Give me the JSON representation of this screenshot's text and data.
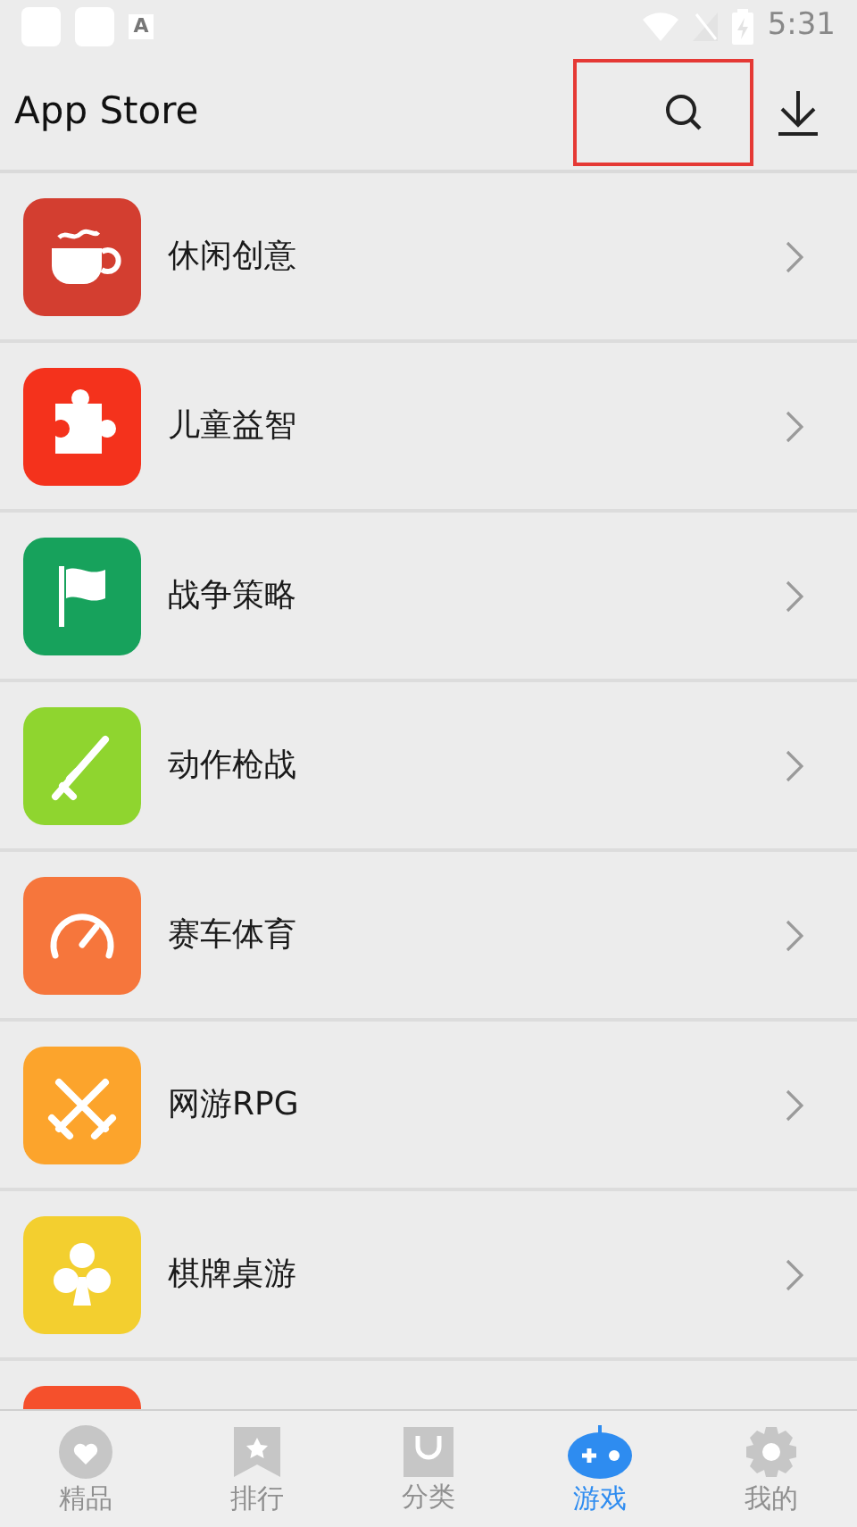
{
  "status_bar": {
    "time": "5:31",
    "notification_badge": "A"
  },
  "header": {
    "title": "App Store",
    "search_highlighted": true
  },
  "categories": [
    {
      "label": "休闲创意",
      "color": "#d33e30"
    },
    {
      "label": "儿童益智",
      "color": "#f4321c"
    },
    {
      "label": "战争策略",
      "color": "#17a25c"
    },
    {
      "label": "动作枪战",
      "color": "#8fd52f"
    },
    {
      "label": "赛车体育",
      "color": "#f6763c"
    },
    {
      "label": "网游RPG",
      "color": "#fca42c"
    },
    {
      "label": "棋牌桌游",
      "color": "#f3cf2f"
    }
  ],
  "partial_category": {
    "color": "#f5502c"
  },
  "bottom_nav": [
    {
      "label": "精品",
      "selected": false
    },
    {
      "label": "排行",
      "selected": false
    },
    {
      "label": "分类",
      "selected": false
    },
    {
      "label": "游戏",
      "selected": true
    },
    {
      "label": "我的",
      "selected": false
    }
  ]
}
